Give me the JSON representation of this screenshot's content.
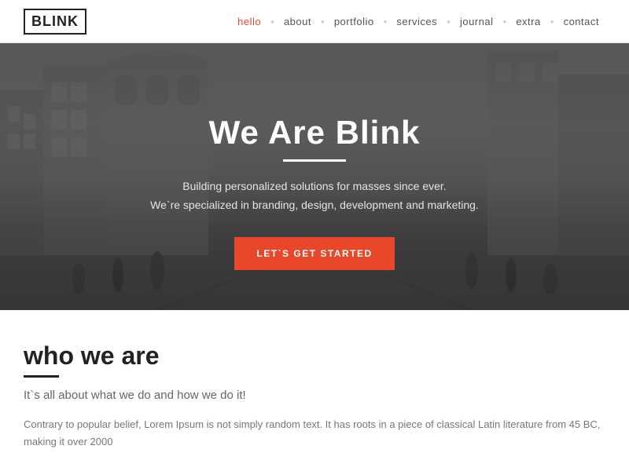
{
  "header": {
    "logo": "BLINK",
    "nav": {
      "items": [
        {
          "label": "hello",
          "active": true
        },
        {
          "label": "about",
          "active": false
        },
        {
          "label": "portfolio",
          "active": false
        },
        {
          "label": "services",
          "active": false
        },
        {
          "label": "journal",
          "active": false
        },
        {
          "label": "extra",
          "active": false
        },
        {
          "label": "contact",
          "active": false
        }
      ]
    }
  },
  "hero": {
    "title": "We Are Blink",
    "subtitle_line1": "Building personalized solutions for masses since ever.",
    "subtitle_line2": "We`re specialized in branding, design, development and marketing.",
    "cta_button": "LET`S GET STARTED"
  },
  "about": {
    "title": "who we are",
    "subtitle": "It`s all about what we do and how we do it!",
    "body": "Contrary to popular belief, Lorem Ipsum is not simply random text. It has roots in a piece of classical Latin literature from 45 BC, making it over 2000"
  }
}
